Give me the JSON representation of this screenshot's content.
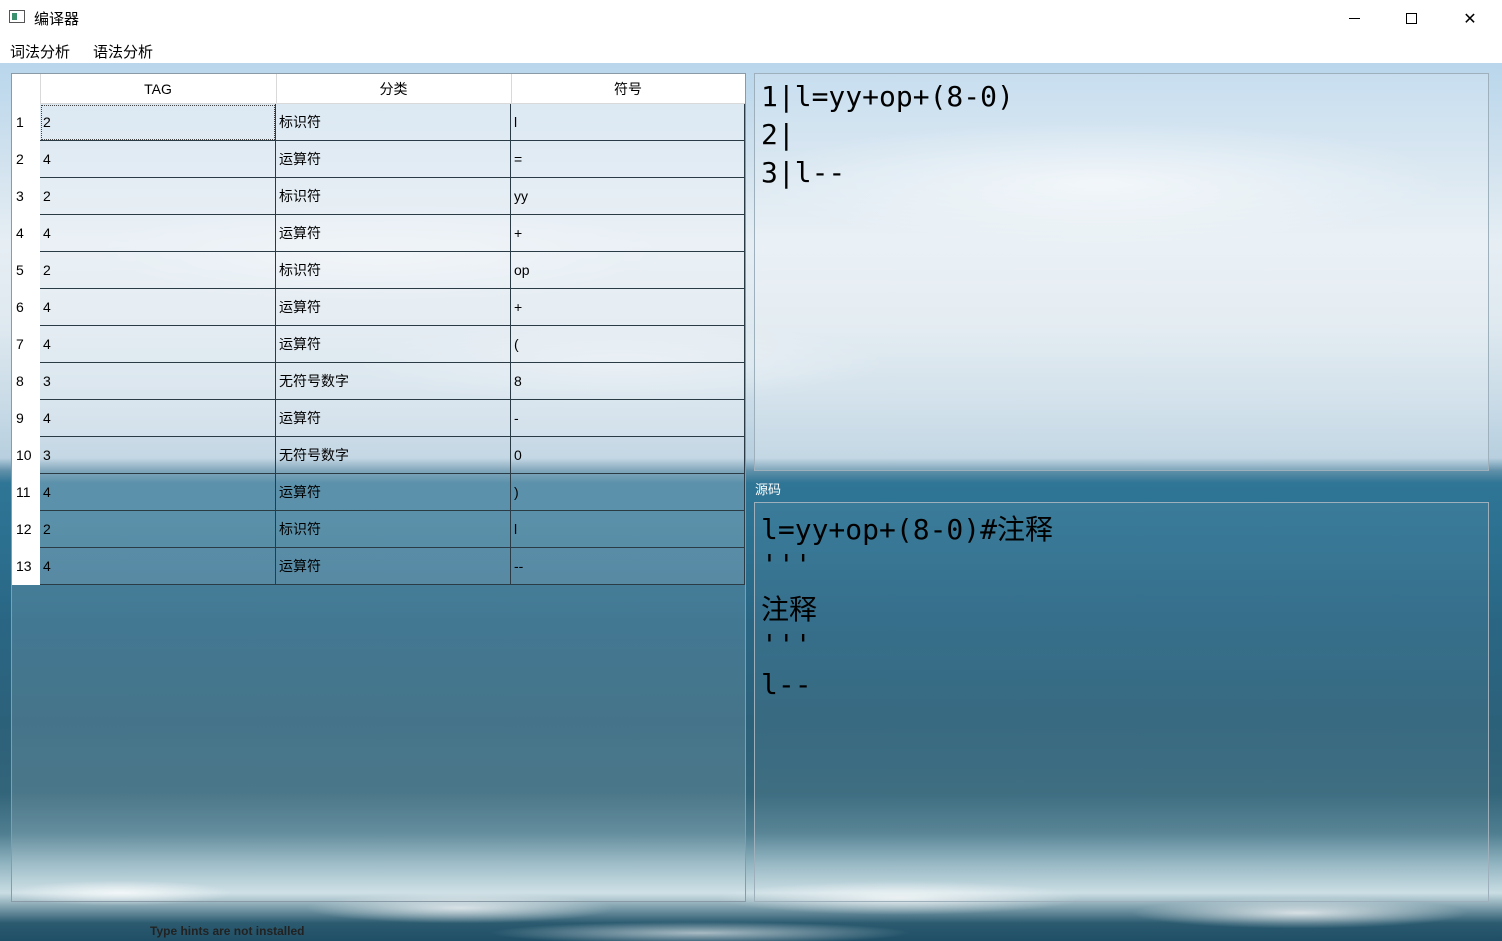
{
  "window": {
    "title": "编译器",
    "minimize_glyph": "minimize-icon",
    "maximize_glyph": "maximize-icon",
    "close_glyph": "✕"
  },
  "menu": {
    "items": [
      "词法分析",
      "语法分析"
    ]
  },
  "token_table": {
    "columns": [
      "TAG",
      "分类",
      "符号"
    ],
    "rows": [
      {
        "num": "1",
        "tag": "2",
        "category": "标识符",
        "symbol": "l"
      },
      {
        "num": "2",
        "tag": "4",
        "category": "运算符",
        "symbol": "="
      },
      {
        "num": "3",
        "tag": "2",
        "category": "标识符",
        "symbol": "yy"
      },
      {
        "num": "4",
        "tag": "4",
        "category": "运算符",
        "symbol": "+"
      },
      {
        "num": "5",
        "tag": "2",
        "category": "标识符",
        "symbol": "op"
      },
      {
        "num": "6",
        "tag": "4",
        "category": "运算符",
        "symbol": "+"
      },
      {
        "num": "7",
        "tag": "4",
        "category": "运算符",
        "symbol": "("
      },
      {
        "num": "8",
        "tag": "3",
        "category": "无符号数字",
        "symbol": "8"
      },
      {
        "num": "9",
        "tag": "4",
        "category": "运算符",
        "symbol": "-"
      },
      {
        "num": "10",
        "tag": "3",
        "category": "无符号数字",
        "symbol": "0"
      },
      {
        "num": "11",
        "tag": "4",
        "category": "运算符",
        "symbol": ")"
      },
      {
        "num": "12",
        "tag": "2",
        "category": "标识符",
        "symbol": "l"
      },
      {
        "num": "13",
        "tag": "4",
        "category": "运算符",
        "symbol": "--"
      }
    ]
  },
  "code_view": {
    "lines": [
      "1|l=yy+op+(8-0)",
      "2|",
      "3|l--"
    ]
  },
  "source": {
    "label": "源码",
    "lines": [
      "l=yy+op+(8-0)#注释",
      "'''",
      "注释",
      "'''",
      "l--"
    ]
  },
  "background_peek_text": "Type hints are not installed",
  "colors": {
    "grid_line": "#2b3b45",
    "header_bg": "#ffffff",
    "label_text": "#ffffff"
  }
}
